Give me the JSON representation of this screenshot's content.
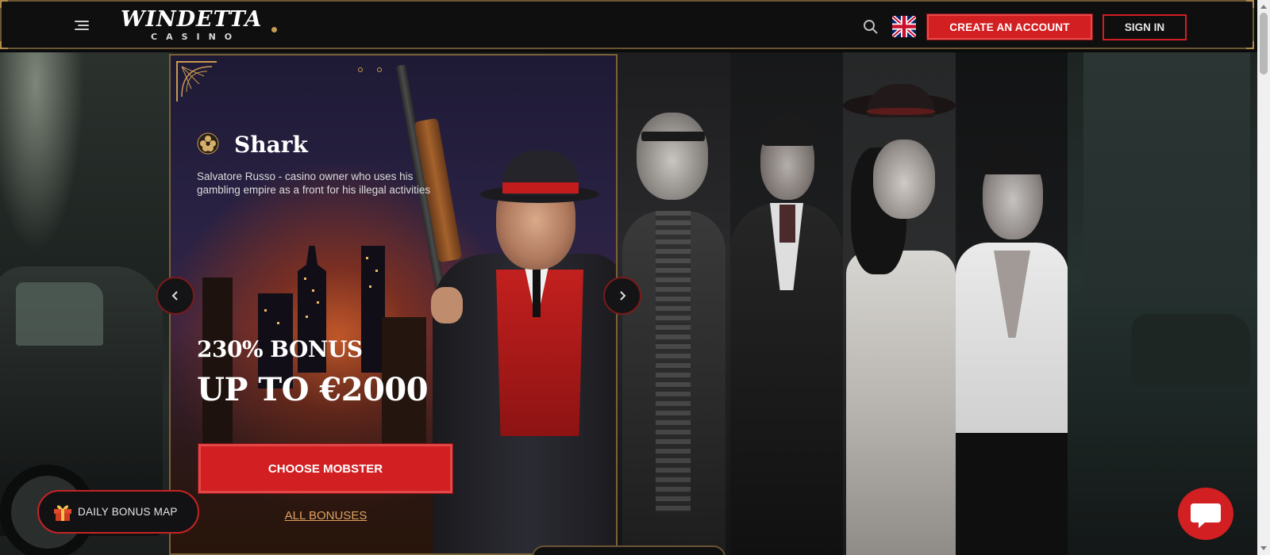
{
  "header": {
    "logo_main": "WINDETTA",
    "logo_sub": "CASINO",
    "create_account_label": "CREATE AN ACCOUNT",
    "sign_in_label": "SIGN IN",
    "menu_icon": "hamburger-icon",
    "search_icon": "search-icon",
    "language_flag": "uk-flag-icon"
  },
  "hero": {
    "character_name": "Shark",
    "character_description": "Salvatore Russo - casino owner who uses his gambling empire as a front for his illegal activities",
    "bonus_line1": "230% BONUS",
    "bonus_line2": "UP TO €2000",
    "choose_button_label": "CHOOSE MOBSTER",
    "all_bonuses_label": "ALL BONUSES"
  },
  "floating": {
    "daily_bonus_label": "DAILY BONUS MAP",
    "chat_icon": "chat-icon"
  },
  "colors": {
    "accent_red": "#d21f22",
    "gold_border": "#7a6237",
    "link_orange": "#e0a260",
    "background": "#0b0b0c"
  }
}
